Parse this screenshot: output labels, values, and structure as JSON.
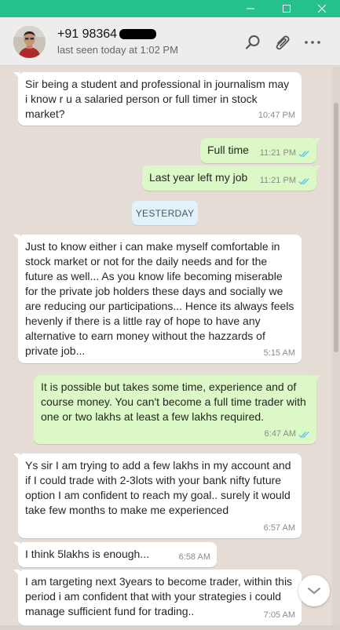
{
  "window": {
    "titlebar_color": "#25c18c",
    "controls": [
      "minimize-icon",
      "maximize-icon",
      "close-icon"
    ]
  },
  "header": {
    "contact_name": "+91 98364",
    "last_seen": "last seen today at 1:02 PM",
    "icons": [
      "search-icon",
      "attachment-icon",
      "more-options-icon"
    ]
  },
  "date_divider": "YESTERDAY",
  "messages": [
    {
      "dir": "in",
      "text": "Sir being a student and professional in journalism may i know r  u a salaried  person or full timer in stock market?",
      "time": "10:47 PM"
    },
    {
      "dir": "out",
      "text": "Full time",
      "time": "11:21 PM",
      "read": true
    },
    {
      "dir": "out",
      "text": "Last year left my job",
      "time": "11:21 PM",
      "read": true
    },
    {
      "dir": "in",
      "text": "Just to know either i can make myself comfortable in stock market or not for the daily needs and for the future as well... As you know life becoming miserable for the private job holders these days and  socially we are reducing our participations... Hence its always feels hevenly if there is a little ray of hope to have any alternative to earn money without the hazzards of private job...",
      "time": "5:15 AM"
    },
    {
      "dir": "out",
      "text": "It is possible but takes some time, experience and of course money. You can't become a full time trader with one or two lakhs at least a  few lakhs required.",
      "time": "6:47 AM",
      "read": true
    },
    {
      "dir": "in",
      "text": "Ys sir I am trying to add a few lakhs in my account and if I could trade with 2-3lots with your bank nifty future option I am confident to  reach my goal.. surely it would take few months to make me experienced",
      "time": "6:57 AM"
    },
    {
      "dir": "in",
      "text": "I think 5lakhs is enough...",
      "time": "6:58 AM"
    },
    {
      "dir": "in",
      "text": "I am targeting  next 3years to become trader, within this period i am confident that  with your strategies i could manage sufficient fund for trading..",
      "time": "7:05 AM"
    }
  ],
  "colors": {
    "incoming_bubble": "#ffffff",
    "outgoing_bubble": "#dcf8c6",
    "read_ticks": "#4fc3f7",
    "chat_background": "#e5ddd5"
  }
}
